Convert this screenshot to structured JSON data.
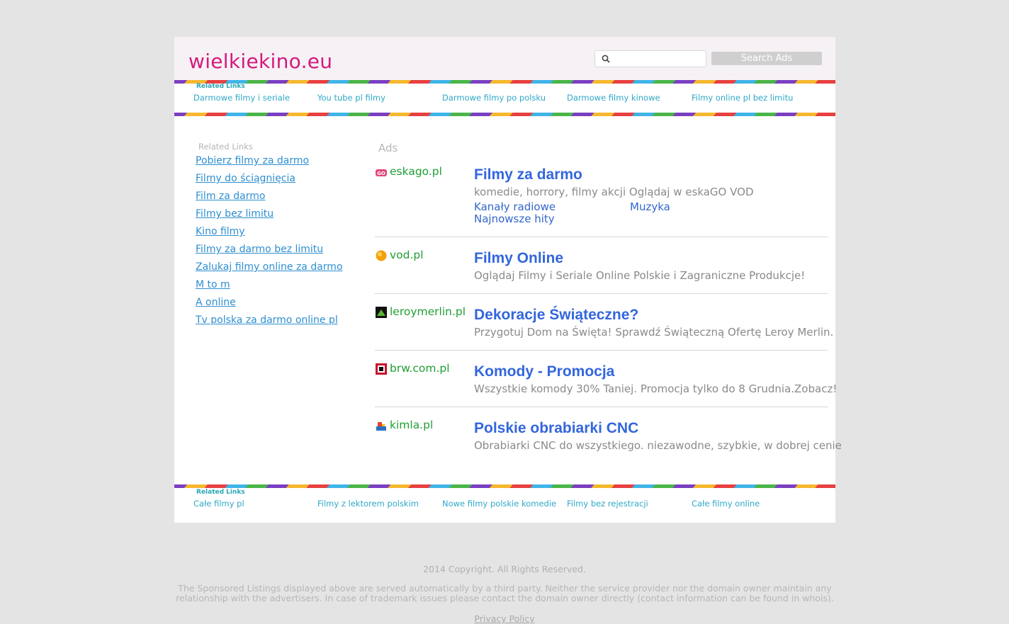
{
  "header": {
    "site_title": "wielkiekino.eu",
    "search_placeholder": "",
    "search_button": "Search Ads"
  },
  "top_links": {
    "label": "Related Links",
    "items": [
      "Darmowe filmy i seriale",
      "You tube pl filmy",
      "Darmowe filmy po polsku",
      "Darmowe filmy kinowe",
      "Filmy online pl bez limitu"
    ]
  },
  "sidebar": {
    "title": "Related Links",
    "items": [
      "Pobierz filmy za darmo",
      "Filmy do ściągnięcia",
      "Film za darmo",
      "Filmy bez limitu",
      "Kino filmy",
      "Filmy za darmo bez limitu",
      "Zalukaj filmy online za darmo",
      "M to m",
      "A online",
      "Tv polska za darmo online pl"
    ]
  },
  "ads": {
    "title": "Ads",
    "items": [
      {
        "domain": "eskago.pl",
        "icon": "eskago-favicon",
        "headline": "Filmy za darmo",
        "description": "komedie, horrory, filmy akcji Oglądaj w eskaGO VOD",
        "sublinks": [
          "Kanały radiowe",
          "Muzyka",
          "Najnowsze hity"
        ]
      },
      {
        "domain": "vod.pl",
        "icon": "vod-favicon",
        "headline": "Filmy Online",
        "description": "Oglądaj Filmy i Seriale Online Polskie i Zagraniczne Produkcje!"
      },
      {
        "domain": "leroymerlin.pl",
        "icon": "leroymerlin-favicon",
        "headline": "Dekoracje Świąteczne?",
        "description": "Przygotuj Dom na Święta! Sprawdź Świąteczną Ofertę Leroy Merlin."
      },
      {
        "domain": "brw.com.pl",
        "icon": "brw-favicon",
        "headline": "Komody - Promocja",
        "description": "Wszystkie komody 30% Taniej. Promocja tylko do 8 Grudnia.Zobacz!"
      },
      {
        "domain": "kimla.pl",
        "icon": "kimla-favicon",
        "headline": "Polskie obrabiarki CNC",
        "description": "Obrabiarki CNC do wszystkiego. niezawodne, szybkie, w dobrej cenie"
      }
    ]
  },
  "bottom_links": {
    "label": "Related Links",
    "items": [
      "Całe filmy pl",
      "Filmy z lektorem polskim",
      "Nowe filmy polskie komedie",
      "Filmy bez rejestracji",
      "Całe filmy online"
    ]
  },
  "footer": {
    "copyright": "2014 Copyright. All Rights Reserved.",
    "note": "The Sponsored Listings displayed above are served automatically by a third party. Neither the service provider nor the domain owner maintain any relationship with the advertisers. In case of trademark issues please contact the domain owner directly (contact information can be found in whois).",
    "privacy": "Privacy Policy"
  },
  "colors": {
    "brand": "#d6197e",
    "link": "#2fa8c8",
    "headline": "#3366dd",
    "domain": "#1f9f33"
  }
}
